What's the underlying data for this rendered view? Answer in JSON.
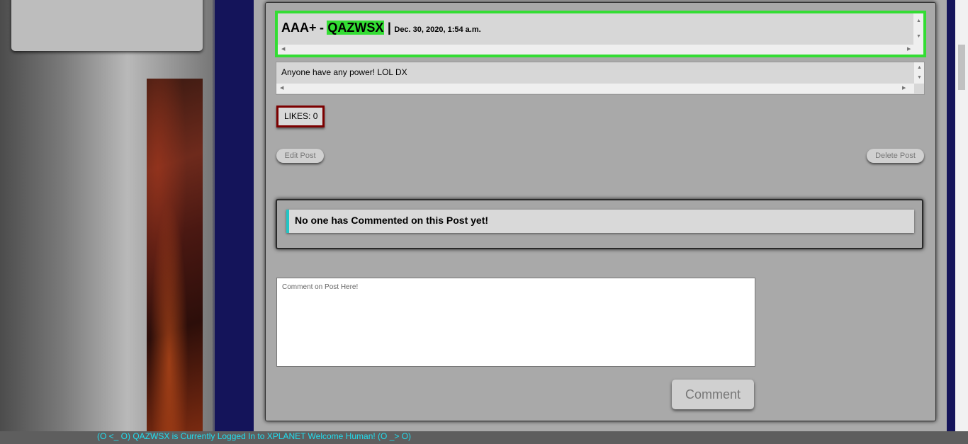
{
  "post": {
    "title": "AAA+",
    "separator": "-",
    "username": "QAZWSX",
    "divider": "|",
    "date": "Dec. 30, 2020, 1:54 a.m.",
    "body": "Anyone have any power! LOL DX",
    "likes_label": "LIKES: 0",
    "edit_label": "Edit Post",
    "delete_label": "Delete Post"
  },
  "comments": {
    "empty_message": "No one has Commented on this Post yet!",
    "input_placeholder": "Comment on Post Here!",
    "submit_label": "Comment"
  },
  "status_bar": {
    "text": "(O <_ O) QAZWSX is Currently Logged In to XPLANET Welcome Human! (O _> O)"
  },
  "colors": {
    "highlight_green": "#33dd33",
    "likes_border": "#7c0000",
    "accent_cyan": "#22c5c5",
    "navy_bg": "#14145a",
    "status_text": "#22ddee"
  }
}
